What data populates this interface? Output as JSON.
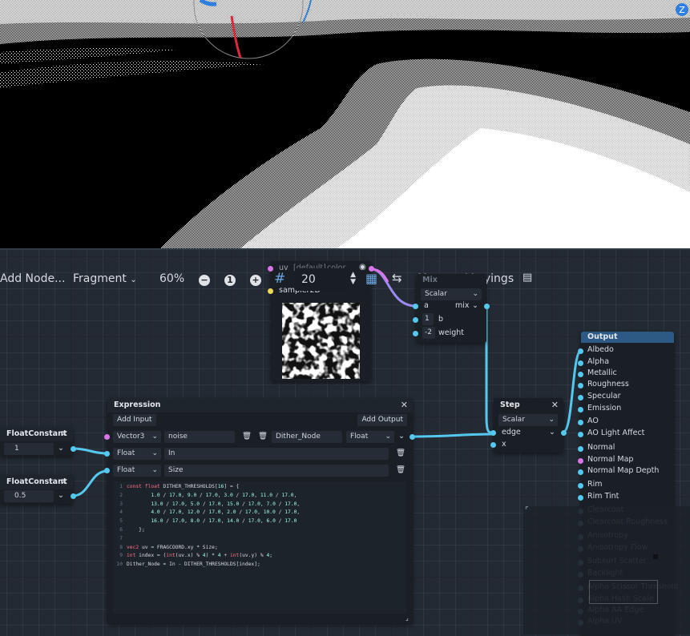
{
  "viewport": {
    "gizmo_label": "Z"
  },
  "toolbar": {
    "add_node": "Add Node...",
    "mode": "Fragment",
    "zoom": "60%",
    "zoom_out_icon": "minus-circle-icon",
    "zoom_reset": "1",
    "zoom_in_icon": "plus-circle-icon",
    "snap_value": "20",
    "manage_varyings": "Manage Varyings"
  },
  "texture_node": {
    "uv_label": "uv",
    "uv_value": "[default]",
    "color_label": "color",
    "sampler_label": "sampler2D"
  },
  "mix_node": {
    "title": "Mix",
    "type": "Scalar",
    "in_a": "a",
    "out_mix": "mix",
    "b_value": "1",
    "b_label": "b",
    "weight_value": "-2",
    "weight_label": "weight"
  },
  "step_node": {
    "title": "Step",
    "type": "Scalar",
    "edge": "edge",
    "x": "x"
  },
  "output_node": {
    "title": "Output",
    "ports": [
      "Albedo",
      "Alpha",
      "Metallic",
      "Roughness",
      "Specular",
      "Emission",
      "AO",
      "AO Light Affect",
      "Normal",
      "Normal Map",
      "Normal Map Depth",
      "Rim",
      "Rim Tint",
      "Clearcoat",
      "Clearcoat Roughness",
      "Anisotropy",
      "Anisotropy Flow",
      "Subsurf Scatter",
      "Backlight",
      "Alpha Scissor Threshold",
      "Alpha Hash Scale",
      "Alpha AA Edge",
      "Alpha UV"
    ]
  },
  "float1": {
    "title": "FloatConstant",
    "value": "1"
  },
  "float2": {
    "title": "FloatConstant",
    "value": "0.5"
  },
  "expression": {
    "title": "Expression",
    "add_input": "Add Input",
    "add_output": "Add Output",
    "inputs": [
      {
        "type": "Vector3",
        "name": "noise"
      },
      {
        "type": "Float",
        "name": "In"
      },
      {
        "type": "Float",
        "name": "Size"
      }
    ],
    "output": {
      "name": "Dither_Node",
      "type": "Float"
    },
    "code_lines": [
      "const float DITHER_THRESHOLDS[16] = {",
      "        1.0 / 17.0, 9.0 / 17.0, 3.0 / 17.0, 11.0 / 17.0,",
      "        13.0 / 17.0, 5.0 / 17.0, 15.0 / 17.0, 7.0 / 17.0,",
      "        4.0 / 17.0, 12.0 / 17.0, 2.0 / 17.0, 10.0 / 17.0,",
      "        16.0 / 17.0, 8.0 / 17.0, 14.0 / 17.0, 6.0 / 17.0",
      "    };",
      "",
      "vec2 uv = FRAGCOORD.xy * Size;",
      "int index = (int(uv.x) % 4) * 4 + int(uv.y) % 4;",
      "Dither_Node = In - DITHER_THRESHOLDS[index];"
    ],
    "line_numbers": [
      "1",
      "2",
      "3",
      "4",
      "5",
      "6",
      "7",
      "8",
      "9",
      "10"
    ]
  },
  "colors": {
    "graph_bg": "#232a33",
    "wire_float": "#54c8ee",
    "wire_vec": "#d875e8",
    "output_title": "#2c5a84"
  }
}
